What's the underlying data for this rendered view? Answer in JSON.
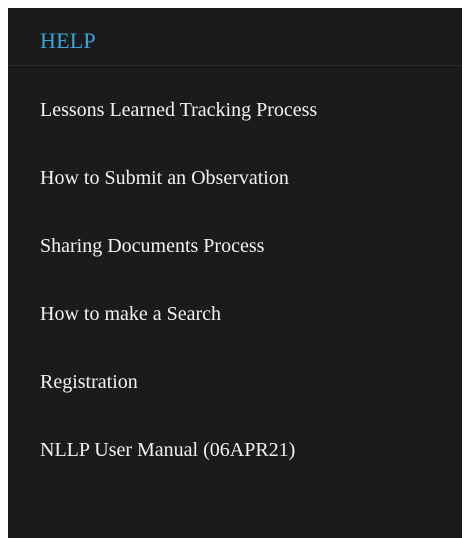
{
  "help_panel": {
    "title": "HELP",
    "items": [
      {
        "label": "Lessons Learned Tracking Process"
      },
      {
        "label": "How to Submit an Observation"
      },
      {
        "label": "Sharing Documents Process"
      },
      {
        "label": "How to make a Search"
      },
      {
        "label": "Registration"
      },
      {
        "label": "NLLP User Manual (06APR21)"
      }
    ]
  },
  "colors": {
    "panel_background": "#1b1b1b",
    "title_accent": "#36a6dc",
    "link_text": "#f2f2f2"
  }
}
